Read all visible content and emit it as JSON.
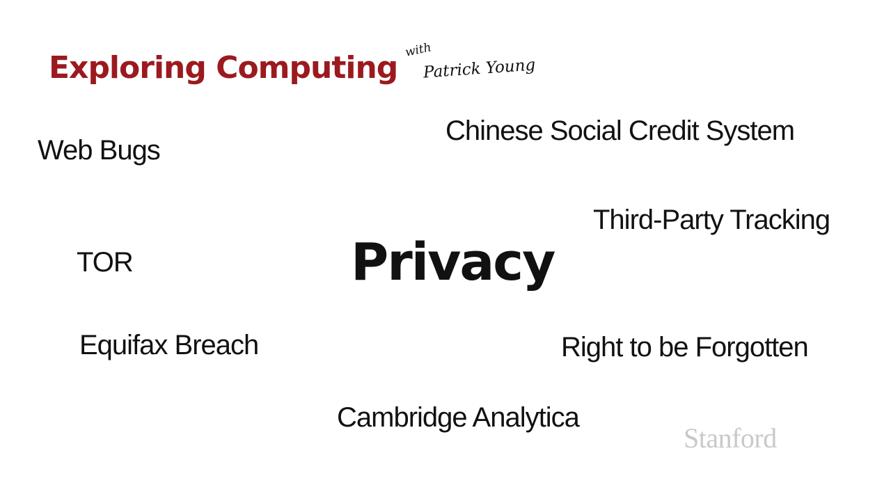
{
  "header": {
    "title": "Exploring Computing",
    "with_label": "with",
    "author": "Patrick Young"
  },
  "main_topic": "Privacy",
  "topics": {
    "web_bugs": "Web Bugs",
    "chinese_social_credit": "Chinese Social Credit System",
    "third_party_tracking": "Third-Party Tracking",
    "tor": "TOR",
    "equifax_breach": "Equifax Breach",
    "right_to_be_forgotten": "Right to be Forgotten",
    "cambridge_analytica": "Cambridge Analytica"
  },
  "footer": {
    "logo_text": "Stanford"
  },
  "colors": {
    "brand_red": "#9b1a1f",
    "text": "#111111",
    "logo_gray": "#c9c9c9",
    "background": "#ffffff"
  }
}
